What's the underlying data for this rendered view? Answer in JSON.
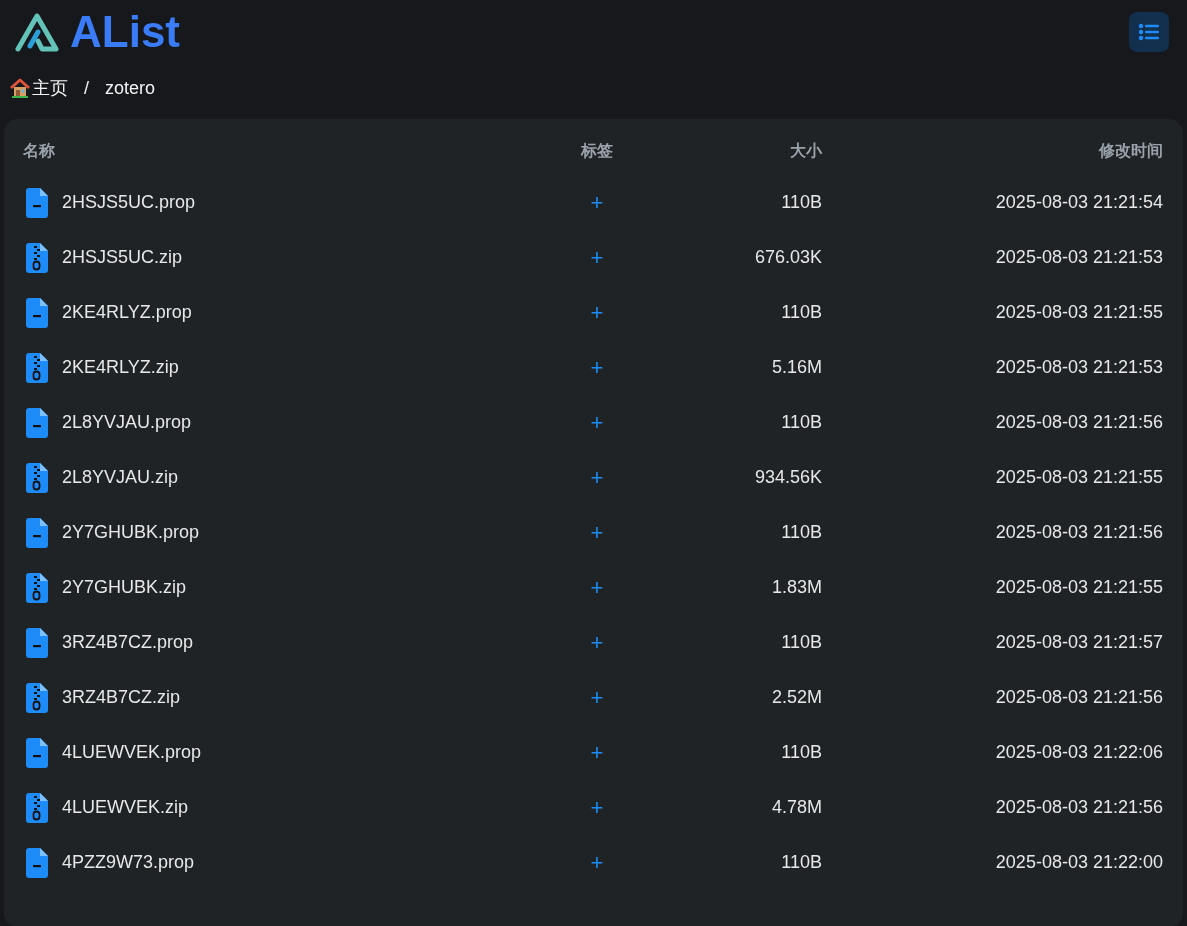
{
  "logo": {
    "text": "AList"
  },
  "breadcrumb": [
    {
      "label": "主页",
      "kind": "home"
    },
    {
      "label": "/",
      "kind": "separator"
    },
    {
      "label": "zotero",
      "kind": "folder"
    }
  ],
  "table": {
    "columns": [
      "名称",
      "标签",
      "大小",
      "修改时间"
    ],
    "rows": [
      {
        "name": "2HSJS5UC.prop",
        "kind": "file",
        "tag": "+",
        "size": "110B",
        "modified": "2025-08-03 21:21:54"
      },
      {
        "name": "2HSJS5UC.zip",
        "kind": "zip",
        "tag": "+",
        "size": "676.03K",
        "modified": "2025-08-03 21:21:53"
      },
      {
        "name": "2KE4RLYZ.prop",
        "kind": "file",
        "tag": "+",
        "size": "110B",
        "modified": "2025-08-03 21:21:55"
      },
      {
        "name": "2KE4RLYZ.zip",
        "kind": "zip",
        "tag": "+",
        "size": "5.16M",
        "modified": "2025-08-03 21:21:53"
      },
      {
        "name": "2L8YVJAU.prop",
        "kind": "file",
        "tag": "+",
        "size": "110B",
        "modified": "2025-08-03 21:21:56"
      },
      {
        "name": "2L8YVJAU.zip",
        "kind": "zip",
        "tag": "+",
        "size": "934.56K",
        "modified": "2025-08-03 21:21:55"
      },
      {
        "name": "2Y7GHUBK.prop",
        "kind": "file",
        "tag": "+",
        "size": "110B",
        "modified": "2025-08-03 21:21:56"
      },
      {
        "name": "2Y7GHUBK.zip",
        "kind": "zip",
        "tag": "+",
        "size": "1.83M",
        "modified": "2025-08-03 21:21:55"
      },
      {
        "name": "3RZ4B7CZ.prop",
        "kind": "file",
        "tag": "+",
        "size": "110B",
        "modified": "2025-08-03 21:21:57"
      },
      {
        "name": "3RZ4B7CZ.zip",
        "kind": "zip",
        "tag": "+",
        "size": "2.52M",
        "modified": "2025-08-03 21:21:56"
      },
      {
        "name": "4LUEWVEK.prop",
        "kind": "file",
        "tag": "+",
        "size": "110B",
        "modified": "2025-08-03 21:22:06"
      },
      {
        "name": "4LUEWVEK.zip",
        "kind": "zip",
        "tag": "+",
        "size": "4.78M",
        "modified": "2025-08-03 21:21:56"
      },
      {
        "name": "4PZZ9W73.prop",
        "kind": "file",
        "tag": "+",
        "size": "110B",
        "modified": "2025-08-03 21:22:00"
      }
    ]
  }
}
